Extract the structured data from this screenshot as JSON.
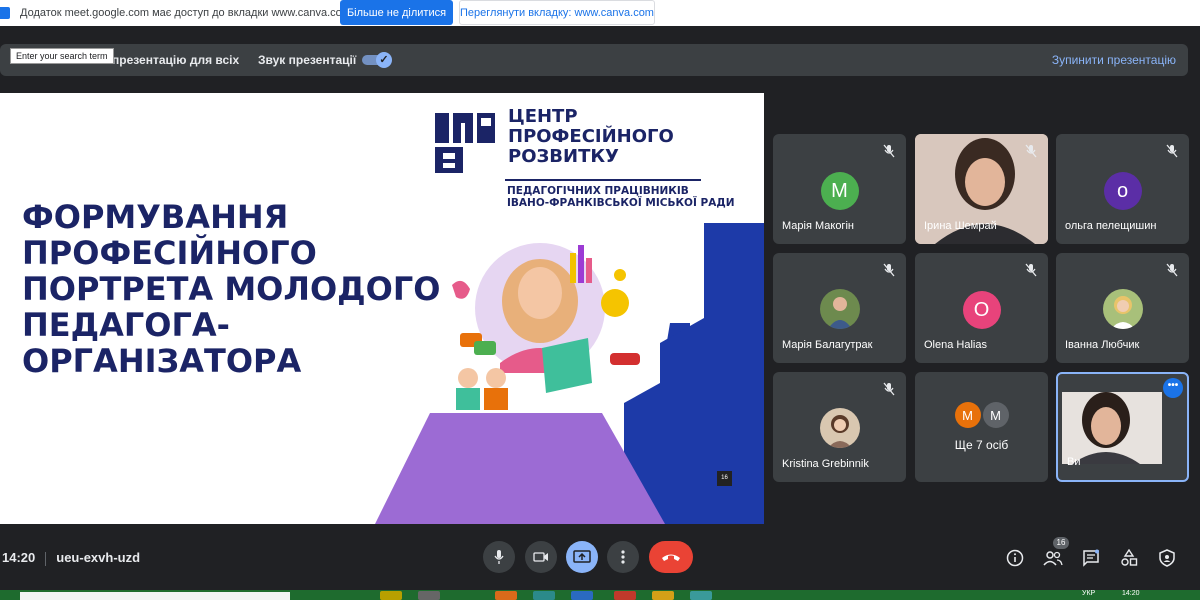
{
  "share_bar": {
    "message": "Додаток meet.google.com має доступ до вкладки www.canva.com",
    "stop_label": "Більше не ділитися",
    "switch_label": "Переглянути вкладку: www.canva.com"
  },
  "presentation_bar": {
    "present_all_label": "презентацію для всіх",
    "sound_label": "Звук презентації",
    "sound_enabled": true,
    "stop_label": "Зупинити презентацію",
    "tooltip": "Enter your search term"
  },
  "slide": {
    "title_lines": [
      "ФОРМУВАННЯ",
      "ПРОФЕСІЙНОГО",
      "ПОРТРЕТА МОЛОДОГО",
      "ПЕДАГОГА-",
      "ОРГАНІЗАТОРА"
    ],
    "logo_lines": [
      "ЦЕНТР",
      "ПРОФЕСІЙНОГО",
      "РОЗВИТКУ"
    ],
    "logo_sub_lines": [
      "ПЕДАГОГІЧНИХ ПРАЦІВНИКІВ",
      "ІВАНО-ФРАНКІВСЬКОЇ МІСЬКОЇ РАДИ"
    ],
    "page_number": "16",
    "colors": {
      "navy": "#1b2466",
      "purple": "#9c6bd4",
      "blue": "#1d3aa8"
    }
  },
  "participants": [
    {
      "name": "Марія Макогін",
      "type": "letter",
      "letter": "М",
      "color": "#4caf50",
      "muted": true
    },
    {
      "name": "Ірина Шемрай",
      "type": "video",
      "muted": true
    },
    {
      "name": "ольга пелещишин",
      "type": "letter",
      "letter": "о",
      "color": "#5b2ea6",
      "muted": true
    },
    {
      "name": "Марія Балагутрак",
      "type": "photo",
      "muted": true
    },
    {
      "name": "Olena Halias",
      "type": "letter",
      "letter": "O",
      "color": "#e8437b",
      "muted": true
    },
    {
      "name": "Іванна Любчик",
      "type": "photo",
      "muted": true
    },
    {
      "name": "Kristina Grebinnik",
      "type": "photo",
      "muted": true
    },
    {
      "name": "Ви",
      "type": "self",
      "muted": false
    }
  ],
  "more_tile": {
    "letters": [
      {
        "letter": "M",
        "color": "#e8710a"
      },
      {
        "letter": "M",
        "color": "#5f6368"
      }
    ],
    "label": "Ще 7 осіб"
  },
  "meeting": {
    "time": "14:20",
    "code": "ueu-exvh-uzd",
    "participant_count": "16"
  },
  "taskbar": {
    "lang": "УКР",
    "time": "14:20"
  }
}
